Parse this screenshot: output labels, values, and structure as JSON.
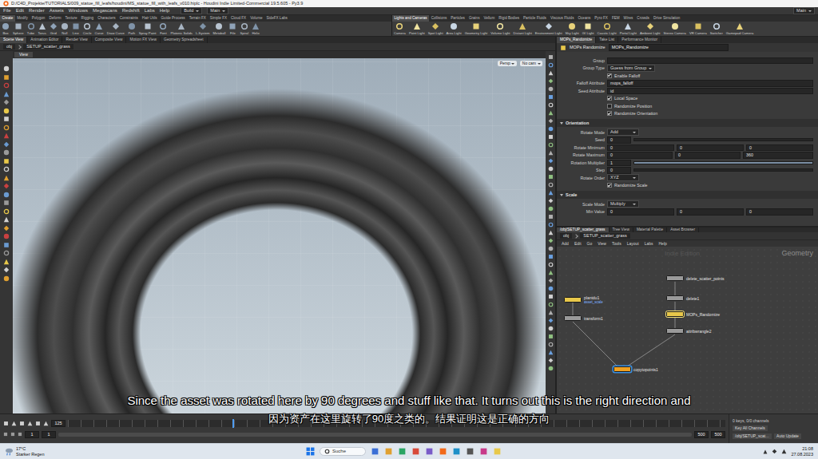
{
  "window": {
    "title": "D:/C4D_Projekte/TUTORIALS/009_statue_fill_leafs/houdini/MS_statue_fill_with_leafs_v010.hiplc - Houdini Indie Limited-Commercial 19.5.605 - Py3.9"
  },
  "menu": [
    "File",
    "Edit",
    "Render",
    "Assets",
    "Windows",
    "Megascans",
    "Redshift",
    "Labs",
    "Help"
  ],
  "desktop": {
    "build": "Build",
    "main": "Main",
    "right": "Main"
  },
  "shelf_tabs_left": [
    {
      "label": "Create",
      "selected": true
    },
    {
      "label": "Modify",
      "selected": false
    },
    {
      "label": "Polygon",
      "selected": false
    },
    {
      "label": "Deform",
      "selected": false
    },
    {
      "label": "Texture",
      "selected": false
    },
    {
      "label": "Rigging",
      "selected": false
    },
    {
      "label": "Characters",
      "selected": false
    },
    {
      "label": "Constraints",
      "selected": false
    },
    {
      "label": "Hair Utils",
      "selected": false
    },
    {
      "label": "Guide Process",
      "selected": false
    },
    {
      "label": "Terrain FX",
      "selected": false
    },
    {
      "label": "Simple FX",
      "selected": false
    },
    {
      "label": "Cloud FX",
      "selected": false
    },
    {
      "label": "Volume",
      "selected": false
    },
    {
      "label": "SideFX Labs",
      "selected": false
    }
  ],
  "shelf_tabs_right": [
    {
      "label": "Lights and Cameras",
      "selected": true
    },
    {
      "label": "Collisions",
      "selected": false
    },
    {
      "label": "Particles",
      "selected": false
    },
    {
      "label": "Grains",
      "selected": false
    },
    {
      "label": "Vellum",
      "selected": false
    },
    {
      "label": "Rigid Bodies",
      "selected": false
    },
    {
      "label": "Particle Fluids",
      "selected": false
    },
    {
      "label": "Viscous Fluids",
      "selected": false
    },
    {
      "label": "Oceans",
      "selected": false
    },
    {
      "label": "Pyro FX",
      "selected": false
    },
    {
      "label": "FEM",
      "selected": false
    },
    {
      "label": "Wires",
      "selected": false
    },
    {
      "label": "Crowds",
      "selected": false
    },
    {
      "label": "Drive Simulation",
      "selected": false
    }
  ],
  "shelf_tools_left": [
    "Box",
    "Sphere",
    "Tube",
    "Torus",
    "Grid",
    "Null",
    "Line",
    "Circle",
    "Curve",
    "Draw Curve",
    "Path",
    "Spray Paint",
    "Font",
    "Platonic Solids",
    "L-System",
    "Metaball",
    "File",
    "Spiral",
    "Helix"
  ],
  "shelf_tools_right": [
    "Camera",
    "Point Light",
    "Spot Light",
    "Area Light",
    "Geometry Light",
    "Volume Light",
    "Distant Light",
    "Environment Light",
    "Sky Light",
    "GI Light",
    "Caustic Light",
    "Portal Light",
    "Ambient Light",
    "Stereo Camera",
    "VR Camera",
    "Switcher",
    "Gamepad Camera"
  ],
  "pane_tabs": [
    {
      "label": "Scene View",
      "selected": true
    },
    {
      "label": "Animation Editor",
      "selected": false
    },
    {
      "label": "Render View",
      "selected": false
    },
    {
      "label": "Composite View",
      "selected": false
    },
    {
      "label": "Motion FX View",
      "selected": false
    },
    {
      "label": "Geometry Spreadsheet",
      "selected": false
    }
  ],
  "path": [
    "obj",
    "SETUP_scatter_grass"
  ],
  "viewport": {
    "tab": "View",
    "camera": "Persp",
    "cam": "No cam"
  },
  "param_tabs": [
    {
      "label": "MOPs_Randomize",
      "selected": true
    },
    {
      "label": "Take List",
      "selected": false
    },
    {
      "label": "Performance Monitor",
      "selected": false
    }
  ],
  "params": {
    "type": "MOPs Randomize",
    "name": "MOPs_Randomize",
    "rows": [
      {
        "kind": "field",
        "label": "Group"
      },
      {
        "kind": "menu",
        "label": "Group Type",
        "value": "Guess from Group"
      },
      {
        "kind": "check",
        "label": "Enable Falloff",
        "checked": true
      },
      {
        "kind": "field",
        "label": "Falloff Attribute",
        "value": "mops_falloff"
      },
      {
        "kind": "field",
        "label": "Seed Attribute",
        "value": "id"
      },
      {
        "kind": "check",
        "label": "Local Space",
        "checked": true
      },
      {
        "kind": "check",
        "label": "Randomize Position",
        "checked": false
      },
      {
        "kind": "check",
        "label": "Randomize Orientation",
        "checked": true
      },
      {
        "kind": "section",
        "label": "Orientation"
      },
      {
        "kind": "menu",
        "label": "Rotate Mode",
        "value": "Add"
      },
      {
        "kind": "slider",
        "label": "Seed",
        "value": "0",
        "level": 0.0
      },
      {
        "kind": "vector",
        "label": "Rotate Minimum",
        "values": [
          "0",
          "0",
          "0"
        ]
      },
      {
        "kind": "vector",
        "label": "Rotate Maximum",
        "values": [
          "0",
          "0",
          "360"
        ]
      },
      {
        "kind": "slider",
        "label": "Rotation Multiplier",
        "value": "1",
        "level": 1.0
      },
      {
        "kind": "slider",
        "label": "Step",
        "value": "0",
        "level": 0.0
      },
      {
        "kind": "menu",
        "label": "Rotate Order",
        "value": "XYZ"
      },
      {
        "kind": "check",
        "label": "Randomize Scale",
        "checked": true
      },
      {
        "kind": "section",
        "label": "Scale"
      },
      {
        "kind": "menu",
        "label": "Scale Mode",
        "value": "Multiply"
      },
      {
        "kind": "vector",
        "label": "Min Value",
        "values": [
          "0",
          "0",
          "0"
        ]
      }
    ]
  },
  "network": {
    "tabs": [
      {
        "label": "/obj/SETUP_scatter_grass",
        "selected": true
      },
      {
        "label": "Tree View",
        "selected": false
      },
      {
        "label": "Material Palette",
        "selected": false
      },
      {
        "label": "Asset Browser",
        "selected": false
      }
    ],
    "path": [
      "obj",
      "SETUP_scatter_grass"
    ],
    "menu": [
      "Add",
      "Edit",
      "Go",
      "View",
      "Tools",
      "Layout",
      "Labs",
      "Help"
    ],
    "watermark": "Indie Edition",
    "context": "Geometry",
    "nodes": [
      {
        "name": "delete_scatter_points",
        "color": "#9a9a9a",
        "selected": false,
        "display": false
      },
      {
        "name": "delete1",
        "color": "#9a9a9a",
        "selected": false,
        "display": false
      },
      {
        "name": "MOPs_Randomize",
        "color": "#e8c84a",
        "selected": true,
        "display": false
      },
      {
        "name": "attribwrangle2",
        "color": "#9a9a9a",
        "selected": false,
        "display": false
      },
      {
        "name": "plantdu1",
        "note": "asset_scale",
        "color": "#e8c84a",
        "selected": false,
        "display": false
      },
      {
        "name": "transform1",
        "color": "#9a9a9a",
        "selected": false,
        "display": false
      },
      {
        "name": "copytopoints1",
        "color": "#f0a020",
        "selected": false,
        "display": true
      }
    ],
    "wires": [
      {
        "from": "delete_scatter_points",
        "to": "delete1"
      },
      {
        "from": "delete1",
        "to": "MOPs_Randomize"
      },
      {
        "from": "MOPs_Randomize",
        "to": "attribwrangle2"
      },
      {
        "from": "plantdu1",
        "to": "transform1"
      },
      {
        "from": "transform1",
        "to": "copytopoints1"
      },
      {
        "from": "attribwrangle2",
        "to": "copytopoints1"
      }
    ]
  },
  "timeline": {
    "frame": "125",
    "start": "1",
    "start_range": "1",
    "end_range": "500",
    "end": "500",
    "level": 0.25,
    "keys": "0 keys, 0/0 channels",
    "key_all": "Key All Channels",
    "path": "/obj/SETUP_scat…",
    "auto_update": "Auto Update"
  },
  "subtitle": {
    "en": "Since the asset was rotated here by 90 degrees and stuff like that. It turns out this is the right direction and",
    "zh": "因为资产在这里旋转了90度之类的。结果证明这是正确的方向"
  },
  "taskbar": {
    "temp": "17°C",
    "weather": "Starker Regen",
    "search": "Suche",
    "time": "21:08",
    "date": "27.08.2023"
  }
}
